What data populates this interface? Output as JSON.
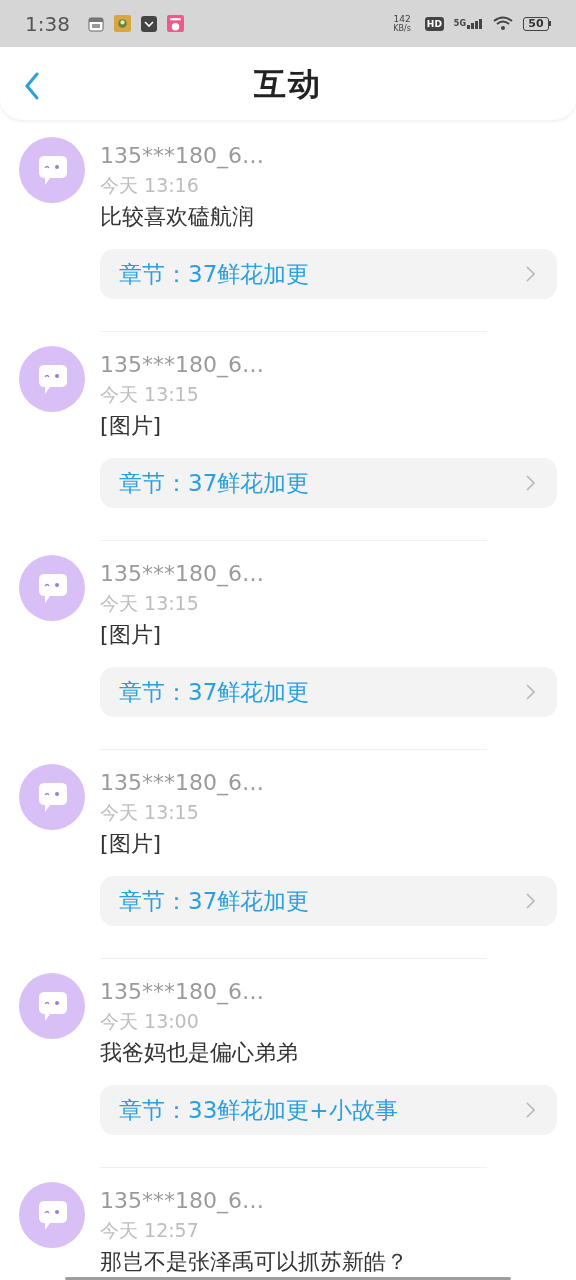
{
  "status_bar": {
    "time": "1:38",
    "speed_value": "142",
    "speed_unit": "KB/s",
    "hd": "HD",
    "network": "5G",
    "battery": "50"
  },
  "header": {
    "title": "互动"
  },
  "comments": [
    {
      "user": "135***180_6…",
      "time": "今天 13:16",
      "text": "比较喜欢磕航润",
      "chapter": "章节：37鲜花加更"
    },
    {
      "user": "135***180_6…",
      "time": "今天 13:15",
      "text": "[图片]",
      "chapter": "章节：37鲜花加更"
    },
    {
      "user": "135***180_6…",
      "time": "今天 13:15",
      "text": "[图片]",
      "chapter": "章节：37鲜花加更"
    },
    {
      "user": "135***180_6…",
      "time": "今天 13:15",
      "text": "[图片]",
      "chapter": "章节：37鲜花加更"
    },
    {
      "user": "135***180_6…",
      "time": "今天 13:00",
      "text": "我爸妈也是偏心弟弟",
      "chapter": "章节：33鲜花加更+小故事"
    },
    {
      "user": "135***180_6…",
      "time": "今天 12:57",
      "text": "那岂不是张泽禹可以抓苏新皓？"
    }
  ]
}
